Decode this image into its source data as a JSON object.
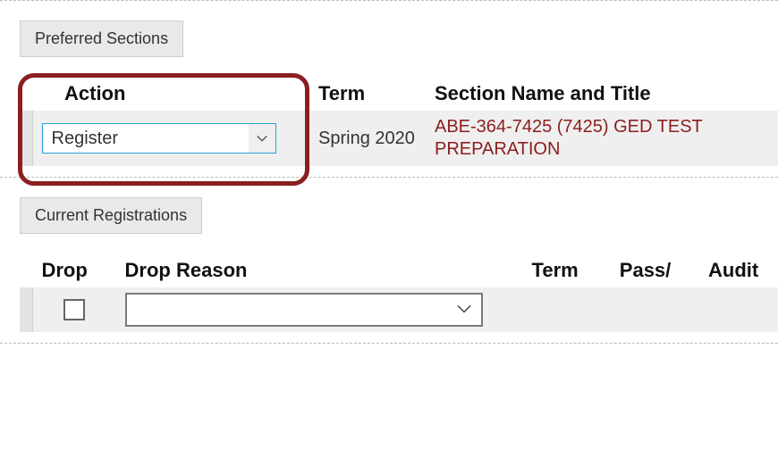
{
  "preferred": {
    "button_label": "Preferred Sections",
    "headers": {
      "action": "Action",
      "term": "Term",
      "section": "Section Name and Title"
    },
    "row": {
      "action_value": "Register",
      "term": "Spring 2020",
      "section": "ABE-364-7425 (7425) GED TEST PREPARATION"
    }
  },
  "current": {
    "button_label": "Current Registrations",
    "headers": {
      "drop": "Drop",
      "drop_reason": "Drop Reason",
      "term": "Term",
      "pass": "Pass/",
      "audit": "Audit"
    },
    "row": {
      "drop_checked": false,
      "drop_reason_value": "",
      "term": "",
      "pass": "",
      "audit": ""
    }
  }
}
